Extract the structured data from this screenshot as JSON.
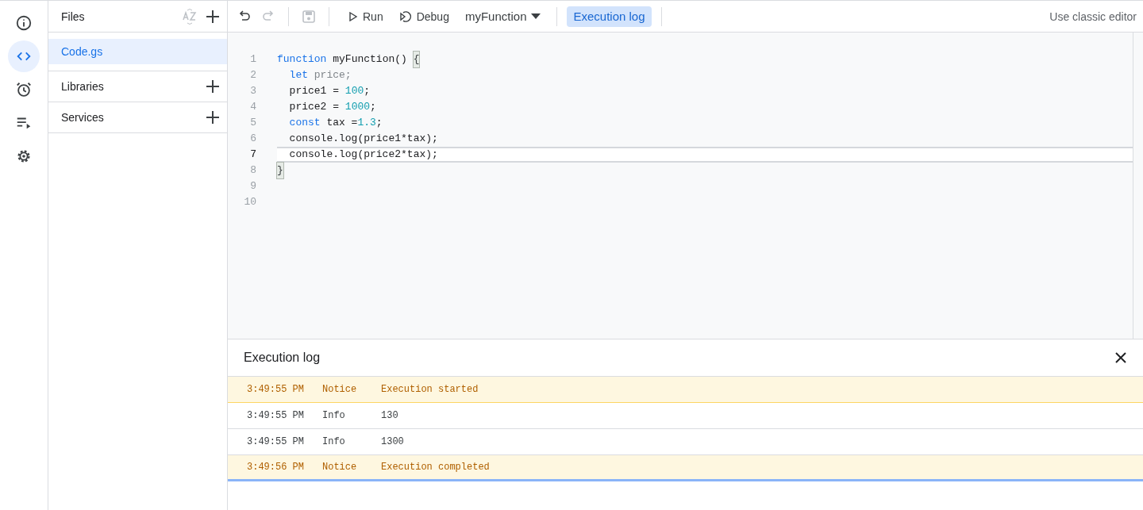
{
  "rail": [
    {
      "kind": "info",
      "selected": false
    },
    {
      "kind": "code",
      "selected": true
    },
    {
      "kind": "triggers",
      "selected": false
    },
    {
      "kind": "executions",
      "selected": false
    },
    {
      "kind": "settings",
      "selected": false
    }
  ],
  "files": {
    "title": "Files",
    "items": [
      {
        "label": "Code.gs",
        "selected": true
      }
    ],
    "sections": [
      "Libraries",
      "Services"
    ]
  },
  "toolbar": {
    "run": "Run",
    "debug": "Debug",
    "function": "myFunction",
    "log_button": {
      "label": "Execution log",
      "selected": true
    },
    "classic": "Use classic editor"
  },
  "editor": {
    "lines": [
      {
        "number": "1",
        "current": false,
        "tokens": [
          {
            "text": "function",
            "kind": "keyword"
          },
          {
            "text": " myFunction() ",
            "kind": "plain"
          },
          {
            "text": "{",
            "kind": "bracket"
          }
        ]
      },
      {
        "number": "2",
        "current": false,
        "tokens": [
          {
            "text": "  let",
            "kind": "keyword"
          },
          {
            "text": " price;",
            "kind": "dim"
          }
        ]
      },
      {
        "number": "3",
        "current": false,
        "tokens": [
          {
            "text": "  price1 = ",
            "kind": "plain"
          },
          {
            "text": "100",
            "kind": "number"
          },
          {
            "text": ";",
            "kind": "plain"
          }
        ]
      },
      {
        "number": "4",
        "current": false,
        "tokens": [
          {
            "text": "  price2 = ",
            "kind": "plain"
          },
          {
            "text": "1000",
            "kind": "number"
          },
          {
            "text": ";",
            "kind": "plain"
          }
        ]
      },
      {
        "number": "5",
        "current": false,
        "tokens": [
          {
            "text": "  const",
            "kind": "keyword"
          },
          {
            "text": " tax =",
            "kind": "plain"
          },
          {
            "text": "1.3",
            "kind": "number"
          },
          {
            "text": ";",
            "kind": "plain"
          }
        ]
      },
      {
        "number": "6",
        "current": false,
        "tokens": [
          {
            "text": "  console.log(price1*tax);",
            "kind": "plain"
          }
        ]
      },
      {
        "number": "7",
        "current": true,
        "tokens": [
          {
            "text": "  console.log(price2*tax);",
            "kind": "plain"
          }
        ]
      },
      {
        "number": "8",
        "current": false,
        "tokens": [
          {
            "text": "}",
            "kind": "bracket"
          }
        ]
      },
      {
        "number": "9",
        "current": false
      },
      {
        "number": "10",
        "current": false
      }
    ]
  },
  "log": {
    "title": "Execution log",
    "rows": [
      {
        "kind": "notice",
        "time": "3:49:55 PM",
        "level": "Notice",
        "message": "Execution started"
      },
      {
        "kind": "info",
        "time": "3:49:55 PM",
        "level": "Info",
        "message": "130"
      },
      {
        "kind": "info",
        "time": "3:49:55 PM",
        "level": "Info",
        "message": "1300"
      },
      {
        "kind": "notice",
        "time": "3:49:56 PM",
        "level": "Notice",
        "message": "Execution completed"
      }
    ]
  }
}
